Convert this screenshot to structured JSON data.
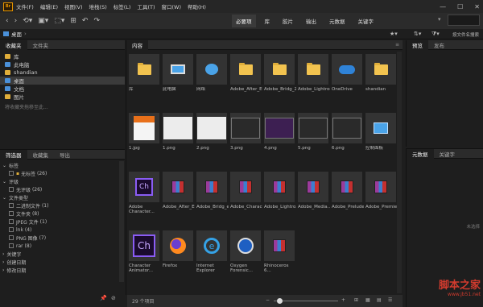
{
  "menu": {
    "items": [
      "文件(F)",
      "编辑(E)",
      "视图(V)",
      "堆栈(S)",
      "标签(L)",
      "工具(T)",
      "窗口(W)",
      "帮助(H)"
    ],
    "logo": "Br"
  },
  "toolbar": {
    "workspaces": [
      "必要项",
      "库",
      "胶片",
      "输出",
      "元数据",
      "关键字"
    ],
    "search_placeholder": "按文件名搜索"
  },
  "path": {
    "location": "桌面"
  },
  "left_top_tabs": [
    "收藏夹",
    "文件夹"
  ],
  "favorites": [
    {
      "label": "库",
      "color": "#e0ae3a"
    },
    {
      "label": "此电脑",
      "color": "#4a90d9"
    },
    {
      "label": "shandian",
      "color": "#e0ae3a"
    },
    {
      "label": "桌面",
      "color": "#4a90d9"
    },
    {
      "label": "文档",
      "color": "#4a90d9"
    },
    {
      "label": "图片",
      "color": "#e0ae3a"
    }
  ],
  "favorites_hint": "将收藏夹拖移至此...",
  "filter_tabs": [
    "筛选器",
    "收藏集",
    "导出"
  ],
  "filter": {
    "sections": [
      {
        "title": "标签",
        "items": [
          {
            "label": "无标签",
            "count": "(26)"
          }
        ]
      },
      {
        "title": "评级",
        "items": [
          {
            "label": "无评级",
            "count": "(26)"
          }
        ]
      },
      {
        "title": "文件类型",
        "items": [
          {
            "label": "二进制文件",
            "count": "(1)"
          },
          {
            "label": "文件夹",
            "count": "(8)"
          },
          {
            "label": "JPEG 文件",
            "count": "(1)"
          },
          {
            "label": "lnk",
            "count": "(4)"
          },
          {
            "label": "PNG 图像",
            "count": "(7)"
          },
          {
            "label": "rar",
            "count": "(8)"
          }
        ]
      },
      {
        "title": "关键字",
        "items": []
      },
      {
        "title": "创建日期",
        "items": []
      },
      {
        "title": "修改日期",
        "items": []
      }
    ]
  },
  "content": {
    "tab": "内容",
    "items": [
      {
        "label": "库",
        "kind": "folder"
      },
      {
        "label": "此电脑",
        "kind": "pc"
      },
      {
        "label": "网络",
        "kind": "net"
      },
      {
        "label": "Adobe_After_Eff.....",
        "kind": "folder"
      },
      {
        "label": "Adobe_Bridg_2.....",
        "kind": "folder"
      },
      {
        "label": "Adobe_Lightroo.....",
        "kind": "folder"
      },
      {
        "label": "OneDrive",
        "kind": "cloud"
      },
      {
        "label": "shandian",
        "kind": "folder"
      },
      {
        "label": "1.jpg",
        "kind": "doc"
      },
      {
        "label": "1.png",
        "kind": "shot"
      },
      {
        "label": "2.png",
        "kind": "shot"
      },
      {
        "label": "3.png",
        "kind": "dark"
      },
      {
        "label": "4.png",
        "kind": "purple"
      },
      {
        "label": "5.png",
        "kind": "dark"
      },
      {
        "label": "6.png",
        "kind": "dark"
      },
      {
        "label": "控制面板",
        "kind": "panel"
      },
      {
        "label": "Adobe Character...",
        "kind": "ch"
      },
      {
        "label": "Adobe_After_Effec...",
        "kind": "rar"
      },
      {
        "label": "Adobe_Bridg_e_2...",
        "kind": "rar"
      },
      {
        "label": "Adobe_Charact...",
        "kind": "rar"
      },
      {
        "label": "Adobe_Lightro.....",
        "kind": "rar"
      },
      {
        "label": "Adobe_Media.....",
        "kind": "rar"
      },
      {
        "label": "Adobe_Prelude.....",
        "kind": "rar"
      },
      {
        "label": "Adobe_Premie.....",
        "kind": "rar"
      },
      {
        "label": "Character Animator...",
        "kind": "chbig"
      },
      {
        "label": "Firefox",
        "kind": "firefox"
      },
      {
        "label": "Internet Explorer",
        "kind": "ie"
      },
      {
        "label": "Oxygen Forensic...",
        "kind": "oxygen"
      },
      {
        "label": "Rhinoceros 6...",
        "kind": "rar"
      }
    ]
  },
  "right_top_tabs": [
    "预览",
    "发布"
  ],
  "right_bottom_tabs": [
    "元数据",
    "关键字"
  ],
  "right_bottom_text": "未选择",
  "status": {
    "count": "29 个项目"
  },
  "watermark": {
    "line1": "脚本之家",
    "line2": "www.jb51.net"
  }
}
